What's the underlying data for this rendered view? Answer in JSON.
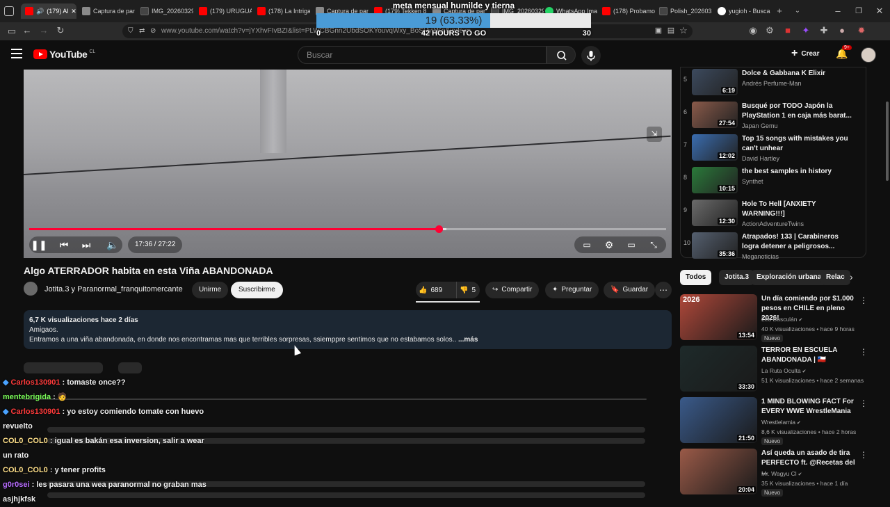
{
  "browser": {
    "tabs": [
      {
        "label": "(179) Al",
        "active": true
      },
      {
        "label": "Captura de pan"
      },
      {
        "label": "IMG_20260329"
      },
      {
        "label": "(179) URUGUAY"
      },
      {
        "label": "(178) La Intriga"
      },
      {
        "label": "Captura de pan"
      },
      {
        "label": "(179) Tekken 8"
      },
      {
        "label": "Captura de pan"
      },
      {
        "label": "IMG_20260329"
      },
      {
        "label": "WhatsApp Ima"
      },
      {
        "label": "(178) Probamo"
      },
      {
        "label": "Polish_2026032"
      },
      {
        "label": "yugioh - Busca"
      }
    ],
    "url": "www.youtube.com/watch?v=jYXhvFIvBZI&list=PLWCBGnn2UbdSOKYouvqWxy_BoSHyikKn&index=..."
  },
  "overlay_goal": {
    "title": "meta mensual humilde y tierna",
    "progress_text": "19 (63.33%)",
    "progress_fraction": 0.6333,
    "min": "0",
    "max": "30",
    "time_left": "42 HOURS TO GO"
  },
  "youtube": {
    "logo": "YouTube",
    "country": "CL",
    "search_placeholder": "Buscar",
    "create_label": "Crear",
    "notif_count": "9+"
  },
  "player": {
    "time": "17:36 / 27:22",
    "played_fraction": 0.643,
    "buffered_fraction": 0.655
  },
  "video": {
    "title": "Algo ATERRADOR habita en esta Viña ABANDONADA",
    "channel": "Jotita.3 y Paranormal_franquitomercante",
    "join_label": "Unirme",
    "subscribe_label": "Suscribirme",
    "likes": "689",
    "dislikes": "5",
    "share_label": "Compartir",
    "ask_label": "Preguntar",
    "save_label": "Guardar",
    "desc_stats": "6,7 K visualizaciones  hace 2 días",
    "desc_line1": "Amigaos.",
    "desc_line2": "Entramos a una viña abandonada, en donde nos encontramas mas que terribles sorpresas, ssiemppre sentimos que no estabamos solos..",
    "desc_more": "...más"
  },
  "chat": [
    {
      "user": "Carlos130901",
      "color": "#ff3b3b",
      "msg": "tomaste once??",
      "badges": true
    },
    {
      "user": "mentebrigida",
      "color": "#7cff5a",
      "msg": "",
      "badges": false
    },
    {
      "user": "Carlos130901",
      "color": "#ff3b3b",
      "msg": "yo estoy comiendo tomate con huevo revuelto",
      "badges": true
    },
    {
      "user": "COL0_COL0",
      "color": "#ffe08a",
      "msg": "igual es bakán esa inversion, salir a wear un rato",
      "badges": false
    },
    {
      "user": "COL0_COL0",
      "color": "#ffe08a",
      "msg": "y tener profits",
      "badges": false
    },
    {
      "user": "g0r0sei",
      "color": "#b86cff",
      "msg": "les pasara una wea paranormal no graban mas asjhjkfsk",
      "badges": false
    }
  ],
  "playlist": [
    {
      "idx": "5",
      "title": "Dolce & Gabbana K Elixir",
      "channel": "Andrés Perfume-Man",
      "duration": "6:19",
      "color": "#3c4a5e"
    },
    {
      "idx": "6",
      "title": "Busqué por TODO Japón la PlayStation 1 en caja más barat...",
      "channel": "Japan Gemu",
      "duration": "27:54",
      "color": "#8a5a4a"
    },
    {
      "idx": "7",
      "title": "Top 15 songs with mistakes you can't unhear",
      "channel": "David Hartley",
      "duration": "12:02",
      "color": "#3a6db0"
    },
    {
      "idx": "8",
      "title": "the best samples in history",
      "channel": "Synthet",
      "duration": "10:15",
      "color": "#2a7a3a"
    },
    {
      "idx": "9",
      "title": "Hole To Hell [ANXIETY WARNING!!!]",
      "channel": "ActionAdventureTwins",
      "duration": "12:30",
      "color": "#6b6b6b"
    },
    {
      "idx": "10",
      "title": "Atrapados! 133 | Carabineros logra detener a peligrosos...",
      "channel": "Meganoticias",
      "duration": "35:36",
      "color": "#556070"
    }
  ],
  "chips": [
    "Todos",
    "Jotita.3",
    "Exploración urbana",
    "Relac"
  ],
  "recommendations": [
    {
      "title": "Un día comiendo por $1.000 pesos en CHILE en pleno 2026!",
      "channel": "Leo Basculán",
      "meta": "40 K visualizaciones • hace 9 horas",
      "badge": "Nuevo",
      "duration": "13:54",
      "color": "#b0483a",
      "thumb_text": "2026"
    },
    {
      "title": "TERROR EN ESCUELA ABANDONADA | 🇨🇱",
      "channel": "La Ruta Oculta",
      "meta": "51 K visualizaciones • hace 2 semanas",
      "badge": "",
      "duration": "33:30",
      "color": "#1e2a2a",
      "thumb_text": ""
    },
    {
      "title": "1 MIND BLOWING FACT For EVERY WWE WrestleMania",
      "channel": "Wrestlelamia",
      "meta": "8,6 K visualizaciones • hace 2 horas",
      "badge": "Nuevo",
      "duration": "21:50",
      "color": "#3a5a8a",
      "thumb_text": ""
    },
    {
      "title": "Así queda un asado de tira PERFECTO  ft. @Recetas del ...",
      "channel": "Mr. Wagyu Cl",
      "meta": "35 K visualizaciones • hace 1 día",
      "badge": "Nuevo",
      "duration": "20:04",
      "color": "#9a5a48",
      "thumb_text": ""
    }
  ]
}
